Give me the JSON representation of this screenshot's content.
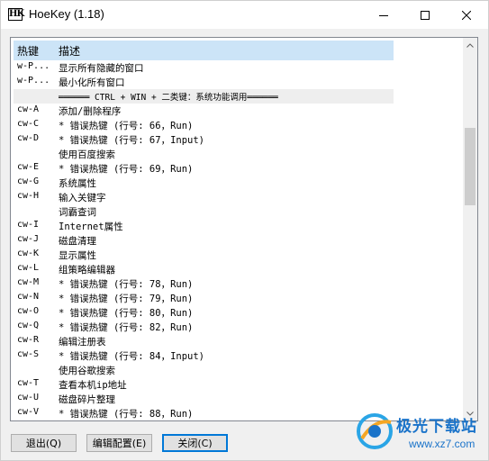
{
  "window": {
    "title": "HoeKey (1.18)",
    "icon_text": "HK"
  },
  "table": {
    "columns": [
      "热键",
      "描述"
    ],
    "rows": [
      {
        "key": "w-P...",
        "desc": "显示所有隐藏的窗口"
      },
      {
        "key": "w-P...",
        "desc": "最小化所有窗口"
      },
      {
        "key": "",
        "desc": "══════ CTRL + WIN + 二类键：系统功能调用══════",
        "separator": true
      },
      {
        "key": "cw-A",
        "desc": "添加/删除程序"
      },
      {
        "key": "cw-C",
        "desc": "* 错误热键 (行号: 66，Run)"
      },
      {
        "key": "cw-D",
        "desc": "* 错误热键 (行号: 67，Input)"
      },
      {
        "key": "",
        "desc": "使用百度搜索"
      },
      {
        "key": "cw-E",
        "desc": "* 错误热键 (行号: 69，Run)"
      },
      {
        "key": "cw-G",
        "desc": "系统属性"
      },
      {
        "key": "cw-H",
        "desc": "输入关键字"
      },
      {
        "key": "",
        "desc": "词霸查词"
      },
      {
        "key": "cw-I",
        "desc": "Internet属性"
      },
      {
        "key": "cw-J",
        "desc": "磁盘清理"
      },
      {
        "key": "cw-K",
        "desc": "显示属性"
      },
      {
        "key": "cw-L",
        "desc": "组策略编辑器"
      },
      {
        "key": "cw-M",
        "desc": "* 错误热键 (行号: 78，Run)"
      },
      {
        "key": "cw-N",
        "desc": "* 错误热键 (行号: 79，Run)"
      },
      {
        "key": "cw-O",
        "desc": "* 错误热键 (行号: 80，Run)"
      },
      {
        "key": "cw-Q",
        "desc": "* 错误热键 (行号: 82，Run)"
      },
      {
        "key": "cw-R",
        "desc": "编辑注册表"
      },
      {
        "key": "cw-S",
        "desc": "* 错误热键 (行号: 84，Input)"
      },
      {
        "key": "",
        "desc": "使用谷歌搜索"
      },
      {
        "key": "cw-T",
        "desc": "查看本机ip地址"
      },
      {
        "key": "cw-U",
        "desc": "磁盘碎片整理"
      },
      {
        "key": "cw-V",
        "desc": "* 错误热键 (行号: 88，Run)"
      }
    ]
  },
  "buttons": {
    "quit": "退出(Q)",
    "config": "编辑配置(E)",
    "close": "关闭(C)"
  },
  "watermark": {
    "name": "极光下载站",
    "url": "www.xz7.com"
  },
  "colors": {
    "header_bg": "#cce4f7",
    "accent": "#0078d7"
  }
}
